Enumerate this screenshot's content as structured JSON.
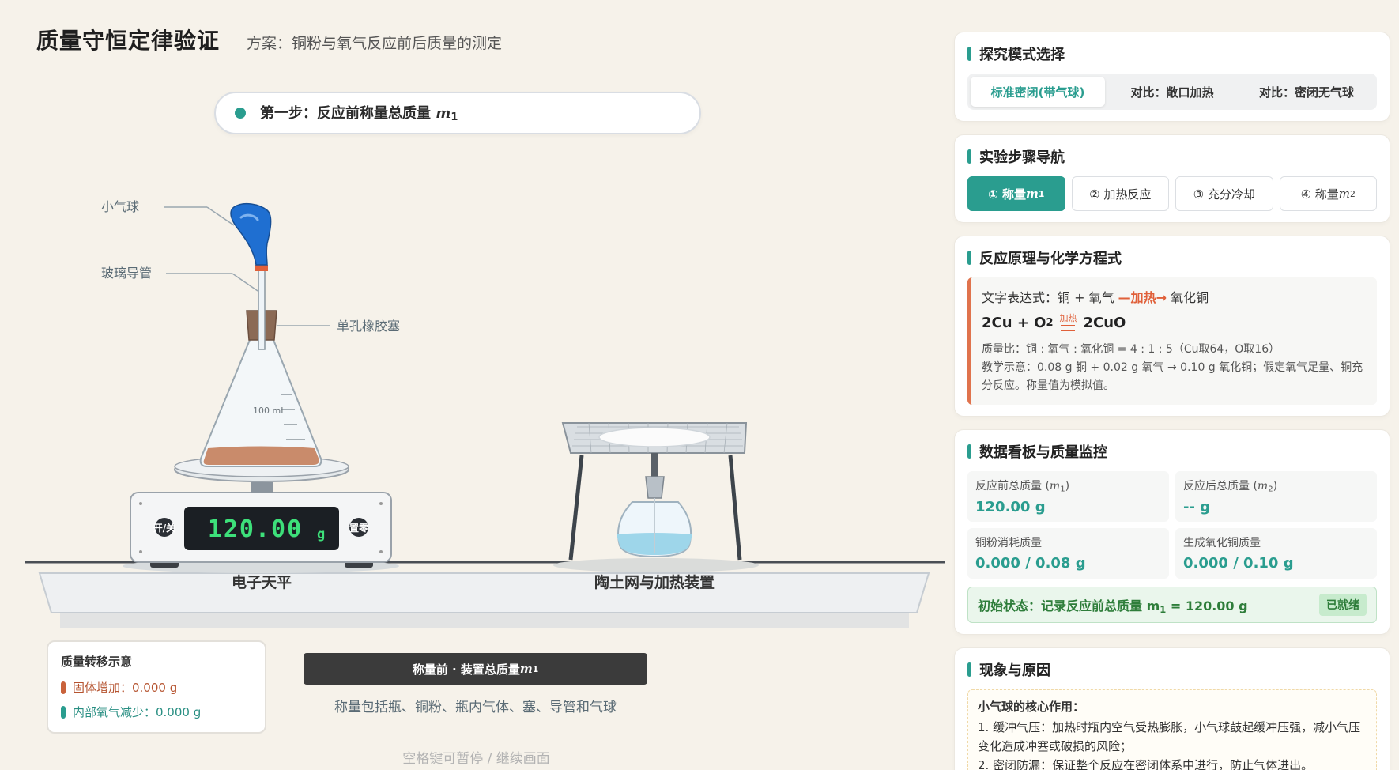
{
  "header": {
    "title": "质量守恒定律验证",
    "subtitle": "方案：铜粉与氧气反应前后质量的测定"
  },
  "step_banner": {
    "text": "第一步：反应前称量总质量 ",
    "symbol": "m",
    "sub": "1"
  },
  "apparatus": {
    "labels": {
      "balloon": "小气球",
      "glass_tube": "玻璃导管",
      "stopper": "单孔橡胶塞",
      "flask_mark": "100 mL",
      "balance": "电子天平",
      "heater": "陶土网与加热装置",
      "btn_onoff": "开/关",
      "btn_tare": "置零"
    },
    "display": {
      "value": "120.00",
      "unit": "g"
    }
  },
  "transfer": {
    "title": "质量转移示意",
    "solid": "固体增加：0.000 g",
    "gas": "内部氧气减少：0.000 g"
  },
  "weigh": {
    "banner_text": "称量前 · 装置总质量 ",
    "symbol": "m",
    "sub": "1",
    "note": "称量包括瓶、铜粉、瓶内气体、塞、导管和气球"
  },
  "hint": "空格键可暂停 / 继续画面",
  "panel": {
    "mode": {
      "title": "探究模式选择",
      "options": [
        "标准密闭(带气球)",
        "对比：敞口加热",
        "对比：密闭无气球"
      ]
    },
    "steps": {
      "title": "实验步骤导航",
      "items": [
        {
          "prefix": "① 称量 ",
          "symbol": "m",
          "sub": "1"
        },
        {
          "prefix": "② 加热反应",
          "symbol": "",
          "sub": ""
        },
        {
          "prefix": "③ 充分冷却",
          "symbol": "",
          "sub": ""
        },
        {
          "prefix": "④ 称量 ",
          "symbol": "m",
          "sub": "2"
        }
      ]
    },
    "principle": {
      "title": "反应原理与化学方程式",
      "word_prefix": "文字表达式：铜 + 氧气 ",
      "word_heat": "—加热→",
      "word_suffix": " 氧化铜",
      "eq_left": "2Cu + O",
      "eq_left_sub": "2",
      "eq_condition": "加热",
      "eq_right": "2CuO",
      "mass_ratio": "质量比：铜 : 氧气 : 氧化铜 = 4 : 1 : 5（Cu取64，O取16）",
      "demo": "教学示意：0.08 g 铜 + 0.02 g 氧气 → 0.10 g 氧化铜；假定氧气足量、铜充分反应。称量值为模拟值。"
    },
    "data": {
      "title": "数据看板与质量监控",
      "before_label": "反应前总质量 (",
      "before_sym": "m",
      "before_sub": "1",
      "before_value": "120.00 g",
      "after_label": "反应后总质量 (",
      "after_sym": "m",
      "after_sub": "2",
      "after_value": "-- g",
      "cu_label": "铜粉消耗质量",
      "cu_value": "0.000 / 0.08 g",
      "cuo_label": "生成氧化铜质量",
      "cuo_value": "0.000 / 0.10 g",
      "status_text": "初始状态：记录反应前总质量 m",
      "status_sub": "1",
      "status_value": " = 120.00 g",
      "status_badge": "已就绪"
    },
    "phenomena": {
      "title": "现象与原因",
      "head": "小气球的核心作用：",
      "line1": "1. 缓冲气压：加热时瓶内空气受热膨胀，小气球鼓起缓冲压强，减小气压变化造成冲塞或破损的风险；",
      "line2": "2. 密闭防漏：保证整个反应在密闭体系中进行，防止气体进出。"
    }
  },
  "colors": {
    "accent": "#2a9d8f",
    "heat": "#e0603a",
    "lcd_text": "#3de07a",
    "balloon": "#1f6fd1",
    "copper": "#c98b6b"
  }
}
